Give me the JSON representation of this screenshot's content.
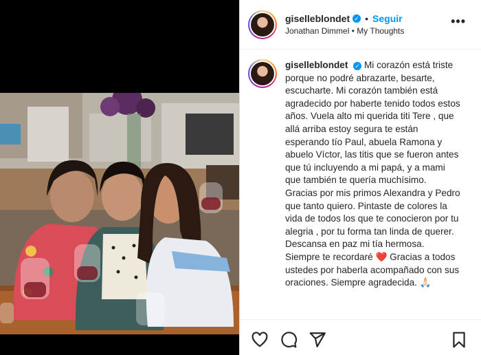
{
  "post": {
    "username": "giselleblondet",
    "follow_label": "Seguir",
    "dot": "•",
    "music": "Jonathan Dimmel • My Thoughts",
    "caption": "Mi corazón está triste porque no podré abrazarte, besarte, escucharte. Mi corazón también está agradecido por haberte tenido todos estos años. Vuela alto mi querida titi Tere , que allá arriba estoy segura te están esperando tío Paul, abuela Ramona y abuelo Víctor, las titis que se fueron antes que tú incluyendo a mi papá, y a mami que también te quería muchísimo. Gracias por mis primos Alexandra y Pedro que tanto quiero. Pintaste de colores la vida de todos los que te conocieron por tu alegria , por tu forma tan linda de querer. Descansa en paz mi tía hermosa. Siempre te recordaré ❤️ Gracias a todos ustedes por haberla acompañado con sus oraciones. Siempre agradecida. 🙏🏻"
  },
  "icons": {
    "verified": "verified-badge-icon",
    "more": "more-options-icon",
    "like": "heart-icon",
    "comment": "comment-icon",
    "share": "send-icon",
    "save": "bookmark-icon"
  },
  "colors": {
    "accent": "#0095f6",
    "text": "#262626"
  }
}
